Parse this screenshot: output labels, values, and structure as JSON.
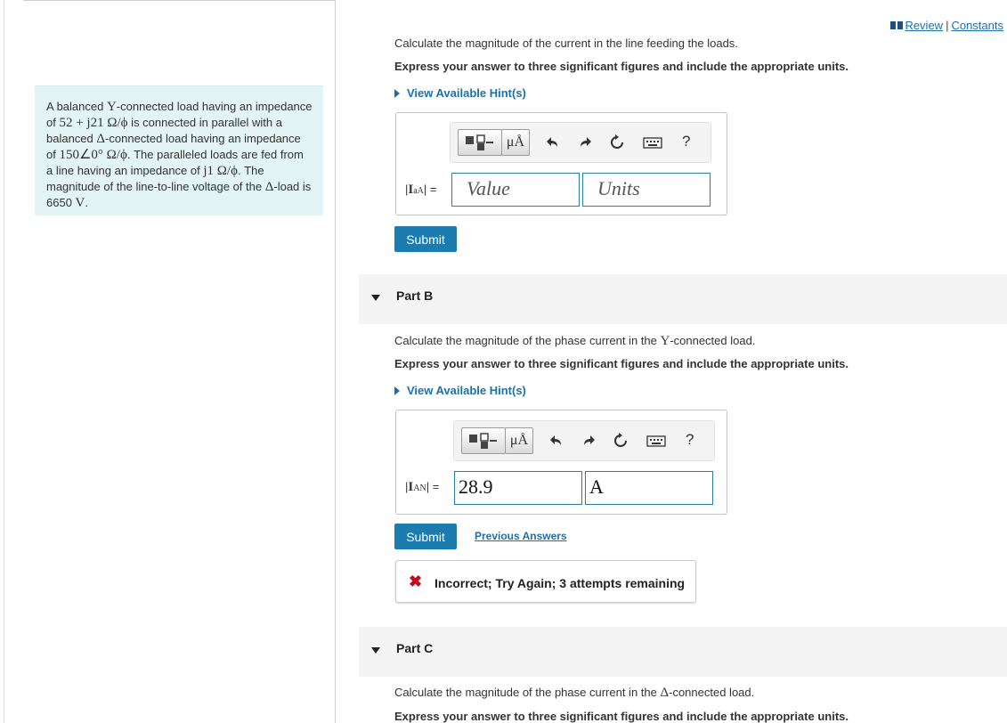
{
  "header": {
    "review_label": "Review",
    "separator": "|",
    "constants_label": "Constants"
  },
  "statement": {
    "t1": "A balanced ",
    "m1": "Y",
    "t2": "-connected load having an impedance of ",
    "m2": "52 + j21 Ω/ϕ",
    "t3": " is connected in parallel with a balanced ",
    "m3": "Δ",
    "t4": "-connected load having an impedance of ",
    "m4": "150∠0° Ω/ϕ",
    "t5": ". The paralleled loads are fed from a line having an impedance of ",
    "m5": "j1 Ω/ϕ",
    "t6": ". The magnitude of the line-to-line voltage of the ",
    "m6": "Δ",
    "t7": "-load is 6650 ",
    "m7": "V",
    "t8": "."
  },
  "partA": {
    "question": "Calculate the magnitude of the current in the line feeding the loads.",
    "instruction": "Express your answer to three significant figures and include the appropriate units.",
    "hint": "View Available Hint(s)",
    "units_btn": "μÅ",
    "help": "?",
    "var_main": "I",
    "var_sub": "aA",
    "equals": "=",
    "value_placeholder": "Value",
    "units_placeholder": "Units",
    "submit": "Submit"
  },
  "partB": {
    "header": "Part B",
    "q1": "Calculate the magnitude of the phase current in the ",
    "qm": "Y",
    "q2": "-connected load.",
    "instruction": "Express your answer to three significant figures and include the appropriate units.",
    "hint": "View Available Hint(s)",
    "units_btn": "μÅ",
    "help": "?",
    "var_main": "I",
    "var_sub": "AN",
    "equals": "=",
    "value": "28.9",
    "units": "A",
    "submit": "Submit",
    "previous": "Previous Answers",
    "feedback": "Incorrect; Try Again; 3 attempts remaining",
    "feedback_icon": "✖"
  },
  "partC": {
    "header": "Part C",
    "q1": "Calculate the magnitude of the phase current in the ",
    "qm": "Δ",
    "q2": "-connected load.",
    "instruction": "Express your answer to three significant figures and include the appropriate units."
  },
  "colors": {
    "accent": "#1c7cb0",
    "link": "#1f6fa8",
    "statement_bg": "#e3f4f4",
    "error": "#d0021b"
  }
}
